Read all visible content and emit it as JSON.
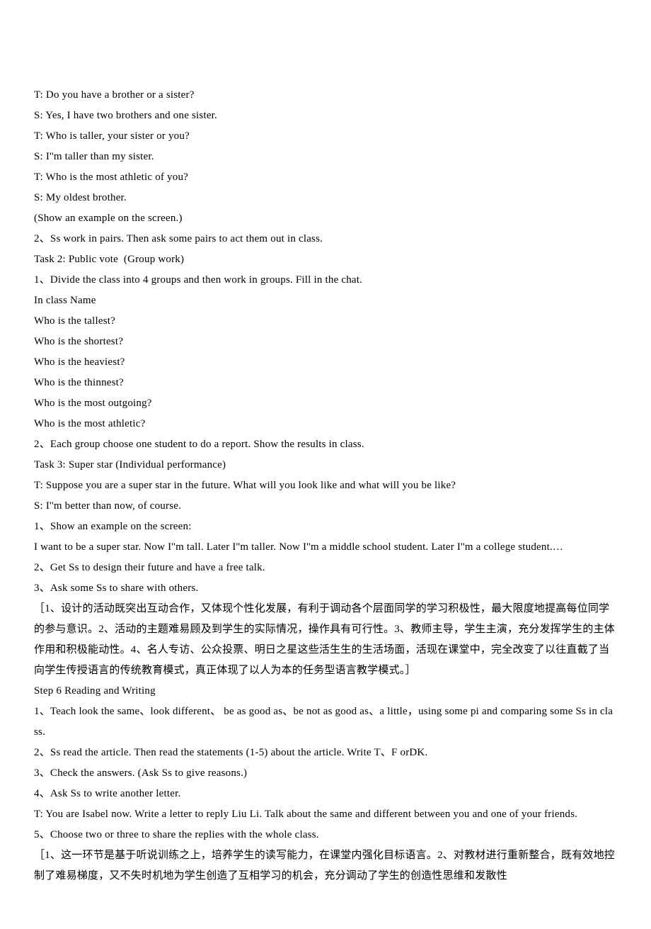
{
  "lines": [
    "T: Do you have a brother or a sister?",
    "S: Yes, I have two brothers and one sister.",
    "T: Who is taller, your sister or you?",
    "S: I''m taller than my sister.",
    "T: Who is the most athletic of you?",
    "S: My oldest brother.",
    "(Show an example on the screen.)",
    "2、Ss work in pairs. Then ask some pairs to act them out in class.",
    "Task 2: Public vote  (Group work)",
    "1、Divide the class into 4 groups and then work in groups. Fill in the chat.",
    "In class Name",
    "Who is the tallest?",
    "Who is the shortest?",
    "Who is the heaviest?",
    "Who is the thinnest?",
    "Who is the most outgoing?",
    "Who is the most athletic?",
    "2、Each group choose one student to do a report. Show the results in class.",
    "Task 3: Super star (Individual performance)",
    "T: Suppose you are a super star in the future. What will you look like and what will you be like?",
    "S: I''m better than now, of course.",
    "1、Show an example on the screen:",
    "I want to be a super star. Now I''m tall. Later I''m taller. Now I''m a middle school student. Later I''m a college student.…",
    "2、Get Ss to design their future and have a free talk.",
    "3、Ask some Ss to share with others.",
    "［1、设计的活动既突出互动合作，又体现个性化发展，有利于调动各个层面同学的学习积极性，最大限度地提高每位同学的参与意识。2、活动的主题难易顾及到学生的实际情况，操作具有可行性。3、教师主导，学生主演，充分发挥学生的主体作用和积极能动性。4、名人专访、公众投票、明日之星这些活生生的生活场面，活现在课堂中，完全改变了以往直截了当向学生传授语言的传统教育模式，真正体现了以人为本的任务型语言教学模式。］",
    "Step 6 Reading and Writing",
    "1、Teach look the same、look different、 be as good as、be not as good as、a little，using some pi and comparing some Ss in class.",
    "2、Ss read the article. Then read the statements (1-5) about the article. Write T、F orDK.",
    "3、Check the answers. (Ask Ss to give reasons.)",
    "4、Ask Ss to write another letter.",
    "T: You are Isabel now. Write a letter to reply Liu Li. Talk about the same and different between you and one of your friends.",
    "5、Choose two or three to share the replies with the whole class.",
    "［1、这一环节是基于听说训练之上，培养学生的读写能力，在课堂内强化目标语言。2、对教材进行重新整合，既有效地控制了难易梯度，又不失时机地为学生创造了互相学习的机会，充分调动了学生的创造性思维和发散性"
  ]
}
